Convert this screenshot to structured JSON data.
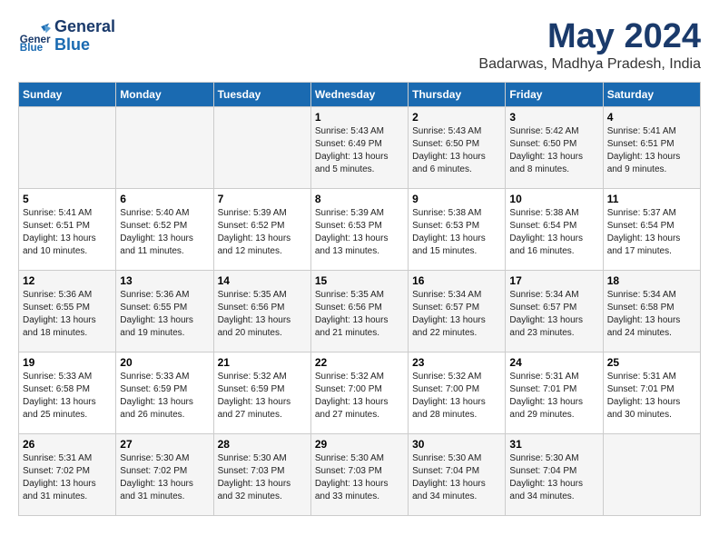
{
  "header": {
    "logo_line1": "General",
    "logo_line2": "Blue",
    "month": "May 2024",
    "location": "Badarwas, Madhya Pradesh, India"
  },
  "days_of_week": [
    "Sunday",
    "Monday",
    "Tuesday",
    "Wednesday",
    "Thursday",
    "Friday",
    "Saturday"
  ],
  "weeks": [
    [
      {
        "day": "",
        "info": ""
      },
      {
        "day": "",
        "info": ""
      },
      {
        "day": "",
        "info": ""
      },
      {
        "day": "1",
        "info": "Sunrise: 5:43 AM\nSunset: 6:49 PM\nDaylight: 13 hours\nand 5 minutes."
      },
      {
        "day": "2",
        "info": "Sunrise: 5:43 AM\nSunset: 6:50 PM\nDaylight: 13 hours\nand 6 minutes."
      },
      {
        "day": "3",
        "info": "Sunrise: 5:42 AM\nSunset: 6:50 PM\nDaylight: 13 hours\nand 8 minutes."
      },
      {
        "day": "4",
        "info": "Sunrise: 5:41 AM\nSunset: 6:51 PM\nDaylight: 13 hours\nand 9 minutes."
      }
    ],
    [
      {
        "day": "5",
        "info": "Sunrise: 5:41 AM\nSunset: 6:51 PM\nDaylight: 13 hours\nand 10 minutes."
      },
      {
        "day": "6",
        "info": "Sunrise: 5:40 AM\nSunset: 6:52 PM\nDaylight: 13 hours\nand 11 minutes."
      },
      {
        "day": "7",
        "info": "Sunrise: 5:39 AM\nSunset: 6:52 PM\nDaylight: 13 hours\nand 12 minutes."
      },
      {
        "day": "8",
        "info": "Sunrise: 5:39 AM\nSunset: 6:53 PM\nDaylight: 13 hours\nand 13 minutes."
      },
      {
        "day": "9",
        "info": "Sunrise: 5:38 AM\nSunset: 6:53 PM\nDaylight: 13 hours\nand 15 minutes."
      },
      {
        "day": "10",
        "info": "Sunrise: 5:38 AM\nSunset: 6:54 PM\nDaylight: 13 hours\nand 16 minutes."
      },
      {
        "day": "11",
        "info": "Sunrise: 5:37 AM\nSunset: 6:54 PM\nDaylight: 13 hours\nand 17 minutes."
      }
    ],
    [
      {
        "day": "12",
        "info": "Sunrise: 5:36 AM\nSunset: 6:55 PM\nDaylight: 13 hours\nand 18 minutes."
      },
      {
        "day": "13",
        "info": "Sunrise: 5:36 AM\nSunset: 6:55 PM\nDaylight: 13 hours\nand 19 minutes."
      },
      {
        "day": "14",
        "info": "Sunrise: 5:35 AM\nSunset: 6:56 PM\nDaylight: 13 hours\nand 20 minutes."
      },
      {
        "day": "15",
        "info": "Sunrise: 5:35 AM\nSunset: 6:56 PM\nDaylight: 13 hours\nand 21 minutes."
      },
      {
        "day": "16",
        "info": "Sunrise: 5:34 AM\nSunset: 6:57 PM\nDaylight: 13 hours\nand 22 minutes."
      },
      {
        "day": "17",
        "info": "Sunrise: 5:34 AM\nSunset: 6:57 PM\nDaylight: 13 hours\nand 23 minutes."
      },
      {
        "day": "18",
        "info": "Sunrise: 5:34 AM\nSunset: 6:58 PM\nDaylight: 13 hours\nand 24 minutes."
      }
    ],
    [
      {
        "day": "19",
        "info": "Sunrise: 5:33 AM\nSunset: 6:58 PM\nDaylight: 13 hours\nand 25 minutes."
      },
      {
        "day": "20",
        "info": "Sunrise: 5:33 AM\nSunset: 6:59 PM\nDaylight: 13 hours\nand 26 minutes."
      },
      {
        "day": "21",
        "info": "Sunrise: 5:32 AM\nSunset: 6:59 PM\nDaylight: 13 hours\nand 27 minutes."
      },
      {
        "day": "22",
        "info": "Sunrise: 5:32 AM\nSunset: 7:00 PM\nDaylight: 13 hours\nand 27 minutes."
      },
      {
        "day": "23",
        "info": "Sunrise: 5:32 AM\nSunset: 7:00 PM\nDaylight: 13 hours\nand 28 minutes."
      },
      {
        "day": "24",
        "info": "Sunrise: 5:31 AM\nSunset: 7:01 PM\nDaylight: 13 hours\nand 29 minutes."
      },
      {
        "day": "25",
        "info": "Sunrise: 5:31 AM\nSunset: 7:01 PM\nDaylight: 13 hours\nand 30 minutes."
      }
    ],
    [
      {
        "day": "26",
        "info": "Sunrise: 5:31 AM\nSunset: 7:02 PM\nDaylight: 13 hours\nand 31 minutes."
      },
      {
        "day": "27",
        "info": "Sunrise: 5:30 AM\nSunset: 7:02 PM\nDaylight: 13 hours\nand 31 minutes."
      },
      {
        "day": "28",
        "info": "Sunrise: 5:30 AM\nSunset: 7:03 PM\nDaylight: 13 hours\nand 32 minutes."
      },
      {
        "day": "29",
        "info": "Sunrise: 5:30 AM\nSunset: 7:03 PM\nDaylight: 13 hours\nand 33 minutes."
      },
      {
        "day": "30",
        "info": "Sunrise: 5:30 AM\nSunset: 7:04 PM\nDaylight: 13 hours\nand 34 minutes."
      },
      {
        "day": "31",
        "info": "Sunrise: 5:30 AM\nSunset: 7:04 PM\nDaylight: 13 hours\nand 34 minutes."
      },
      {
        "day": "",
        "info": ""
      }
    ]
  ]
}
